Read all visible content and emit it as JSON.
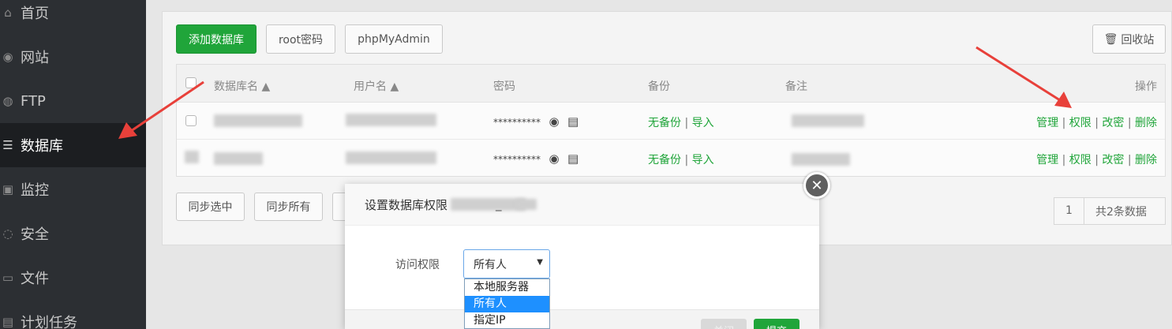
{
  "sidebar": {
    "items": [
      {
        "label": "首页",
        "icon": "home-icon",
        "glyph": "⌂"
      },
      {
        "label": "网站",
        "icon": "globe-icon",
        "glyph": "◉"
      },
      {
        "label": "FTP",
        "icon": "user-icon",
        "glyph": "◍"
      },
      {
        "label": "数据库",
        "icon": "database-icon",
        "glyph": "☰"
      },
      {
        "label": "监控",
        "icon": "monitor-icon",
        "glyph": "▣"
      },
      {
        "label": "安全",
        "icon": "shield-icon",
        "glyph": "◌"
      },
      {
        "label": "文件",
        "icon": "folder-icon",
        "glyph": "▭"
      },
      {
        "label": "计划任务",
        "icon": "clock-icon",
        "glyph": "▤"
      }
    ]
  },
  "toolbar": {
    "add_db": "添加数据库",
    "root_pwd": "root密码",
    "phpmyadmin": "phpMyAdmin",
    "recycle": "回收站"
  },
  "table": {
    "headers": {
      "name": "数据库名 ▲",
      "user": "用户名 ▲",
      "password": "密码",
      "backup": "备份",
      "note": "备注",
      "ops": "操作"
    },
    "rows": [
      {
        "password": "**********",
        "backup": "无备份",
        "import": "导入",
        "ops": [
          "管理",
          "权限",
          "改密",
          "删除"
        ]
      },
      {
        "password": "**********",
        "backup": "无备份",
        "import": "导入",
        "ops": [
          "管理",
          "权限",
          "改密",
          "删除"
        ]
      }
    ]
  },
  "footer": {
    "sync_selected": "同步选中",
    "sync_all": "同步所有",
    "page": "1",
    "total": "共2条数据"
  },
  "dialog": {
    "title": "设置数据库权限",
    "title_suffix": "_",
    "close": "✕",
    "access_label": "访问权限",
    "selected": "所有人",
    "options": [
      "本地服务器",
      "所有人",
      "指定IP"
    ],
    "btn_close": "关闭",
    "btn_confirm": "提交"
  },
  "colors": {
    "accent_green": "#20a53a",
    "arrow_red": "#e8403a",
    "sidebar_bg": "#2c2f33"
  }
}
